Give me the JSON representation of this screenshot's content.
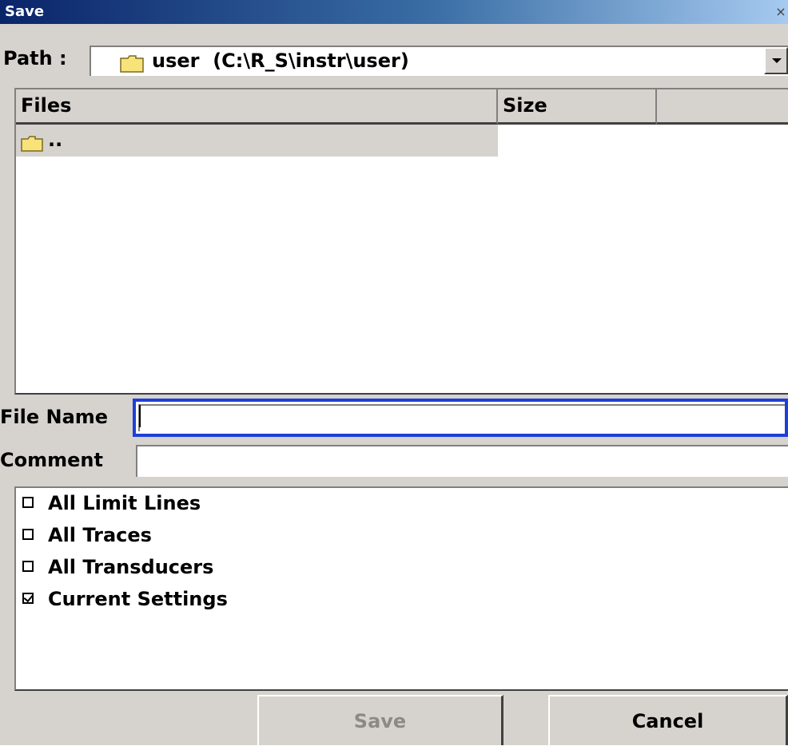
{
  "dialog": {
    "title": "Save",
    "close_glyph": "×"
  },
  "path": {
    "label": "Path :",
    "value": "user  (C:\\R_S\\instr\\user)"
  },
  "filelist": {
    "columns": [
      "Files",
      "Size",
      ""
    ],
    "rows": [
      {
        "name": ".."
      }
    ]
  },
  "fields": {
    "file_name_label": "File Name",
    "file_name_value": "",
    "comment_label": "Comment",
    "comment_value": ""
  },
  "options": [
    {
      "label": "All Limit Lines",
      "checked": false
    },
    {
      "label": "All Traces",
      "checked": false
    },
    {
      "label": "All Transducers",
      "checked": false
    },
    {
      "label": "Current Settings",
      "checked": true
    }
  ],
  "buttons": {
    "save_label": "Save",
    "cancel_label": "Cancel"
  },
  "colors": {
    "title_bar_start": "#0a246a",
    "focus_border": "#1f3fd6",
    "folder_fill": "#f7e37a",
    "disabled_text": "#8c8a86"
  }
}
